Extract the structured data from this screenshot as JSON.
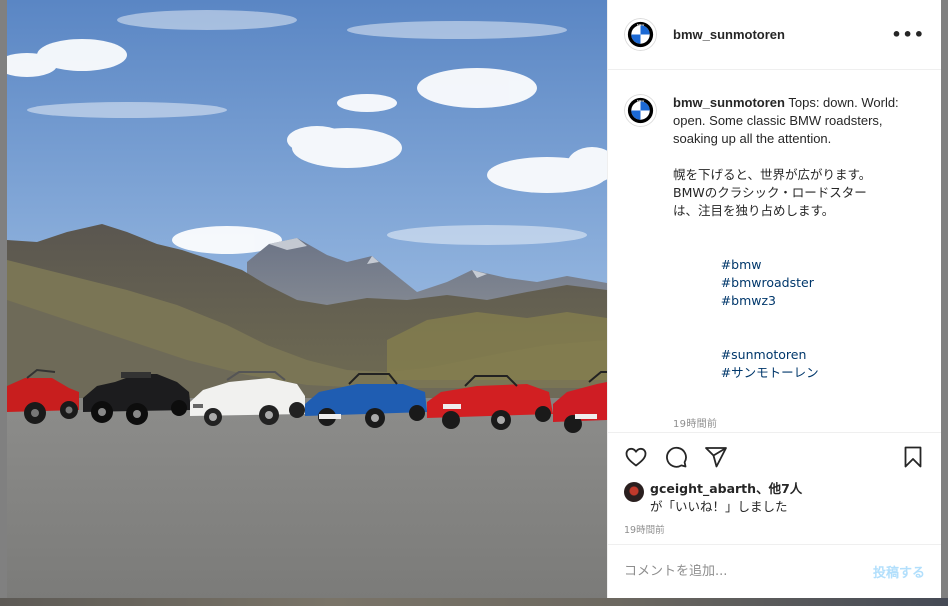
{
  "post": {
    "username": "bmw_sunmotoren",
    "more_label": "•••",
    "caption": {
      "username": "bmw_sunmotoren",
      "lines_en": [
        "Tops: down. World:",
        "open. Some classic BMW roadsters,",
        "soaking up all the attention."
      ],
      "lines_jp": [
        "幌を下げると、世界が広がります。",
        "BMWのクラシック・ロードスター",
        "は、注目を独り占めします。"
      ],
      "hashtags_line1": [
        "#bmw",
        "#bmwroadster",
        "#bmwz3"
      ],
      "hashtags_line2": [
        "#sunmotoren",
        "#サンモトーレン"
      ]
    },
    "caption_time": "19時間前",
    "likes": {
      "first_user": "gceight_abarth",
      "others_label": "、他7人",
      "suffix": "が「いいね！」しました"
    },
    "post_time": "19時間前",
    "comment": {
      "placeholder": "コメントを追加...",
      "post_label": "投稿する"
    }
  },
  "icons": {
    "like": "heart-icon",
    "comment": "comment-icon",
    "share": "paper-plane-icon",
    "save": "bookmark-icon",
    "avatar": "bmw-logo"
  },
  "colors": {
    "text": "#262626",
    "secondary": "#8e8e8e",
    "hashtag": "#00376b",
    "post_button_disabled": "#b2dffc",
    "bmw_blue": "#1c69d4"
  }
}
